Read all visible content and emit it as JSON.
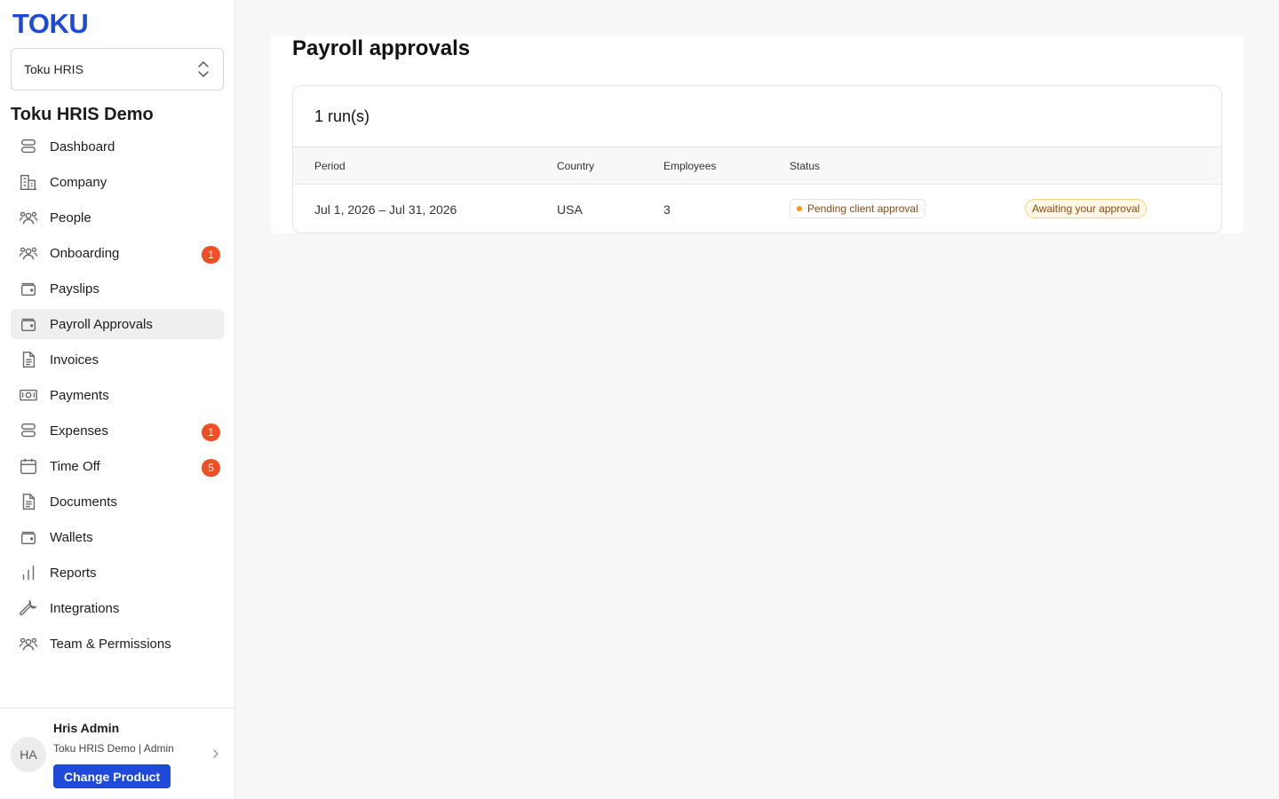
{
  "brand": {
    "logo_text": "TOKU",
    "accent": "#1f49d8"
  },
  "workspace": {
    "selected": "Toku HRIS"
  },
  "org_title": "Toku HRIS Demo",
  "nav": [
    {
      "label": "Dashboard",
      "icon": "layers-icon",
      "badge": ""
    },
    {
      "label": "Company",
      "icon": "building-icon",
      "badge": ""
    },
    {
      "label": "People",
      "icon": "people-icon",
      "badge": ""
    },
    {
      "label": "Onboarding",
      "icon": "people-icon",
      "badge": "1"
    },
    {
      "label": "Payslips",
      "icon": "wallet-icon",
      "badge": ""
    },
    {
      "label": "Payroll Approvals",
      "icon": "wallet-icon",
      "badge": "",
      "active": true
    },
    {
      "label": "Invoices",
      "icon": "document-icon",
      "badge": ""
    },
    {
      "label": "Payments",
      "icon": "banknote-icon",
      "badge": ""
    },
    {
      "label": "Expenses",
      "icon": "layers-icon",
      "badge": "1"
    },
    {
      "label": "Time Off",
      "icon": "calendar-icon",
      "badge": "5"
    },
    {
      "label": "Documents",
      "icon": "document-icon",
      "badge": ""
    },
    {
      "label": "Wallets",
      "icon": "wallet-icon",
      "badge": ""
    },
    {
      "label": "Reports",
      "icon": "bar-chart-icon",
      "badge": ""
    },
    {
      "label": "Integrations",
      "icon": "wrench-icon",
      "badge": ""
    },
    {
      "label": "Team & Permissions",
      "icon": "people-icon",
      "badge": ""
    }
  ],
  "profile": {
    "initials": "HA",
    "name": "Hris Admin",
    "subtitle": "Toku HRIS Demo | Admin",
    "change_product": "Change Product"
  },
  "page": {
    "title": "Payroll approvals",
    "runs_count": "1 run(s)",
    "columns": [
      "Period",
      "Country",
      "Employees",
      "Status"
    ],
    "rows": [
      {
        "period": "Jul 1, 2026 – Jul 31, 2026",
        "country": "USA",
        "employees": "3",
        "status": "Pending client approval",
        "approval": "Awaiting your approval"
      }
    ]
  },
  "colors": {
    "badge": "#f04e23",
    "pending_dot": "#f39a12",
    "awaiting_bg": "#fff8e6"
  }
}
